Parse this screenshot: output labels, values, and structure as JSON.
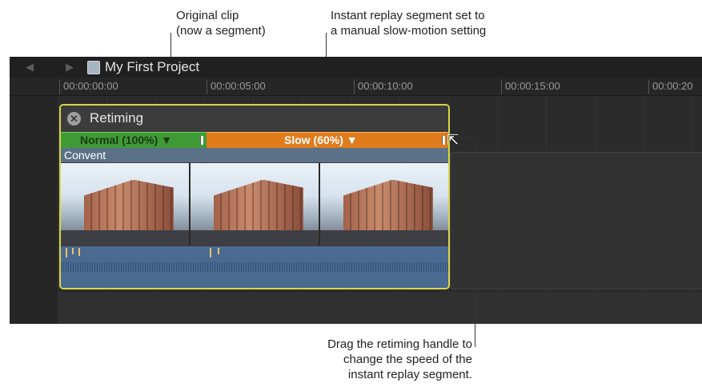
{
  "callouts": {
    "original_clip": [
      "Original clip",
      "(now a segment)"
    ],
    "instant_replay": [
      "Instant replay segment set to",
      "a manual slow-motion setting"
    ],
    "drag_handle": [
      "Drag the retiming handle to",
      "change the speed of the",
      "instant replay segment."
    ]
  },
  "timeline": {
    "project_title": "My First Project",
    "timecodes": [
      "00:00:00:00",
      "00:00:05:00",
      "00:00:10:00",
      "00:00:15:00",
      "00:00:20"
    ]
  },
  "retiming": {
    "label": "Retiming",
    "segments": [
      {
        "label": "Normal (100%) ▼",
        "color": "#3f9a36"
      },
      {
        "label": "Slow (60%) ▼",
        "color": "#e07b1c"
      }
    ]
  },
  "clip": {
    "name": "Convent"
  },
  "colors": {
    "selection": "#d9d64a",
    "clip_title_bg": "#5b7187",
    "audio_bg": "#4a6a91"
  }
}
